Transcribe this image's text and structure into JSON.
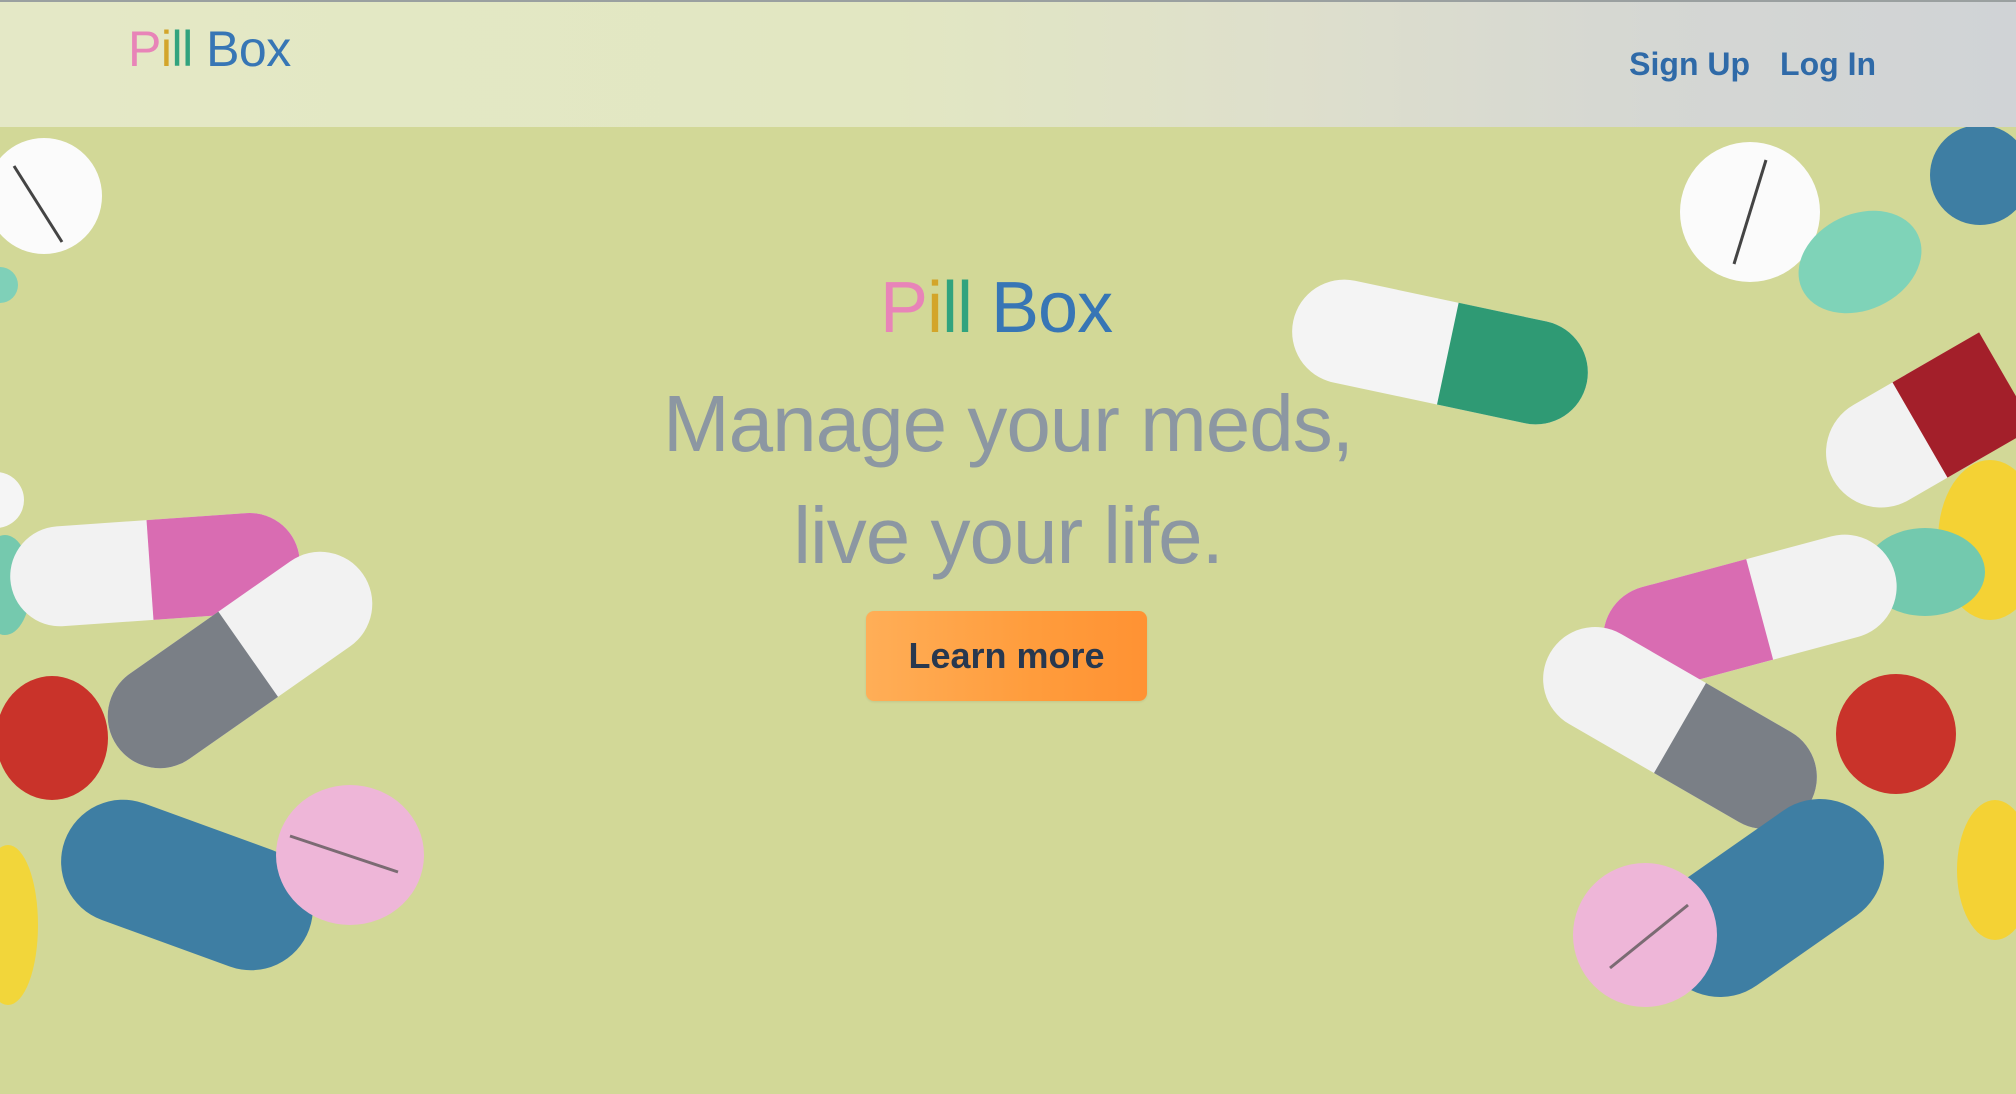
{
  "brand": {
    "part1": "P",
    "part2": "i",
    "part3": "ll",
    "part4": " Box",
    "colors": {
      "p": "#e884b8",
      "i": "#d3a52a",
      "ll": "#31a37e",
      "box": "#3776b5"
    }
  },
  "nav": {
    "signup_label": "Sign Up",
    "login_label": "Log In"
  },
  "hero": {
    "title_part1": "P",
    "title_part2": "i",
    "title_part3": "ll",
    "title_part4": " Box",
    "tagline_line1": "Manage your meds,",
    "tagline_line2": "live your life.",
    "cta_label": "Learn more"
  },
  "theme": {
    "background": "#d2d897",
    "tagline_color": "#8c97a2",
    "nav_link_color": "#2f6aa8",
    "cta_color": "#ff9c3c",
    "cta_text_color": "#28384f"
  },
  "decorations": {
    "icons": [
      "capsule-icon",
      "tablet-icon",
      "round-pill-icon"
    ]
  }
}
